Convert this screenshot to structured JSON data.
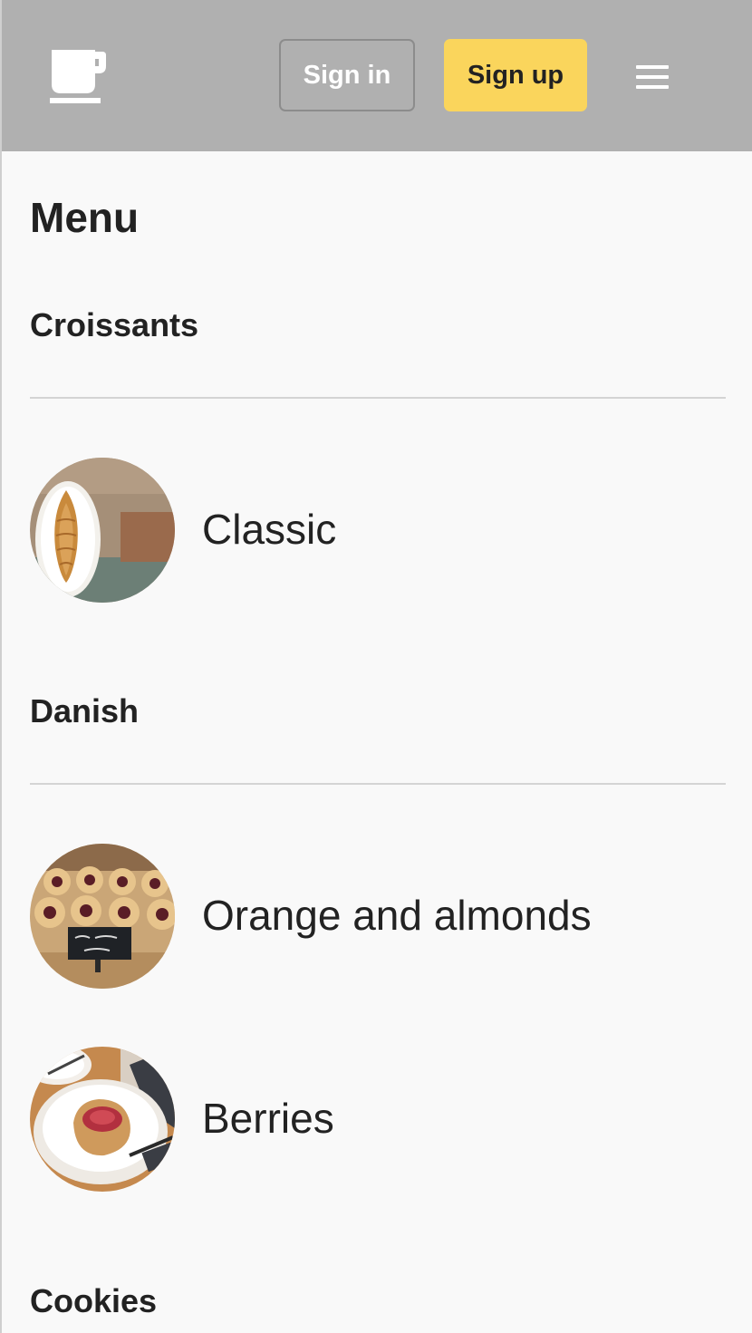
{
  "header": {
    "logo_icon": "coffee-cup-icon",
    "signin_label": "Sign in",
    "signup_label": "Sign up",
    "menu_icon": "hamburger-menu-icon",
    "colors": {
      "header_bg": "#b0b0b0",
      "signup_bg": "#fad55c"
    }
  },
  "main": {
    "title": "Menu",
    "categories": [
      {
        "name": "Croissants",
        "items": [
          {
            "label": "Classic"
          }
        ]
      },
      {
        "name": "Danish",
        "items": [
          {
            "label": "Orange and almonds"
          },
          {
            "label": "Berries"
          }
        ]
      },
      {
        "name": "Cookies",
        "items": []
      }
    ]
  }
}
